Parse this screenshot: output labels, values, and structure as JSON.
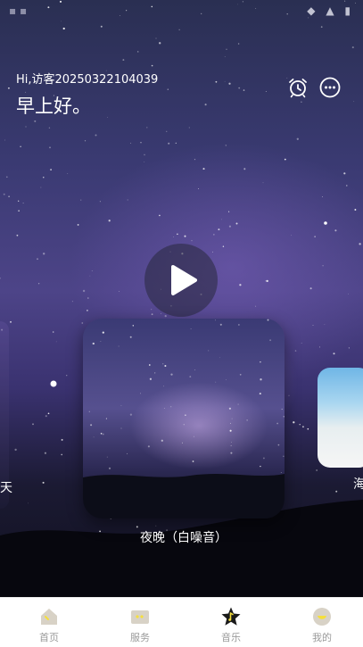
{
  "header": {
    "greeting_line": "Hi,访客20250322104039",
    "greeting_time": "早上好。"
  },
  "icons": {
    "alarm": "alarm-clock-icon",
    "more": "more-options-icon",
    "play": "play-icon"
  },
  "carousel": {
    "left_label": "天",
    "main_label": "夜晚（白噪音）",
    "right_label": "海"
  },
  "tabs": [
    {
      "label": "首页",
      "icon": "home-icon"
    },
    {
      "label": "服务",
      "icon": "service-icon"
    },
    {
      "label": "音乐",
      "icon": "music-star-icon",
      "active": true
    },
    {
      "label": "我的",
      "icon": "profile-icon"
    }
  ],
  "colors": {
    "accent_yellow": "#f5df3c",
    "tab_icon_gray": "#d7d2c8",
    "tab_label": "#9a9a9a"
  }
}
